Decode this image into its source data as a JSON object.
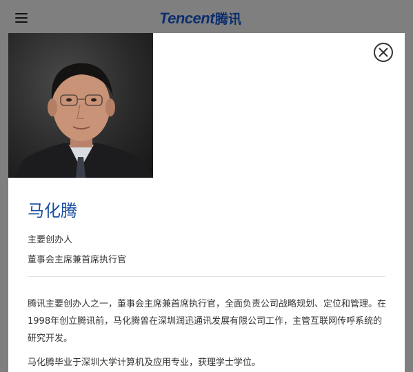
{
  "header": {
    "logo_en": "Tencent",
    "logo_cn": "腾讯",
    "menu_icon": "hamburger-menu-icon"
  },
  "modal": {
    "close_icon": "close-circle-icon",
    "name": "马化腾",
    "roles": [
      "主要创办人",
      "董事会主席兼首席执行官"
    ],
    "bio": [
      "腾讯主要创办人之一，董事会主席兼首席执行官，全面负责公司战略规划、定位和管理。在1998年创立腾讯前，马化腾曾在深圳润迅通讯发展有限公司工作，主管互联网传呼系统的研究开发。",
      "马化腾毕业于深圳大学计算机及应用专业，获理学士学位。"
    ]
  },
  "colors": {
    "overlay": "#7f7f7f",
    "logo": "#0b2e6e",
    "name": "#1a4fa3",
    "text": "#333333"
  }
}
